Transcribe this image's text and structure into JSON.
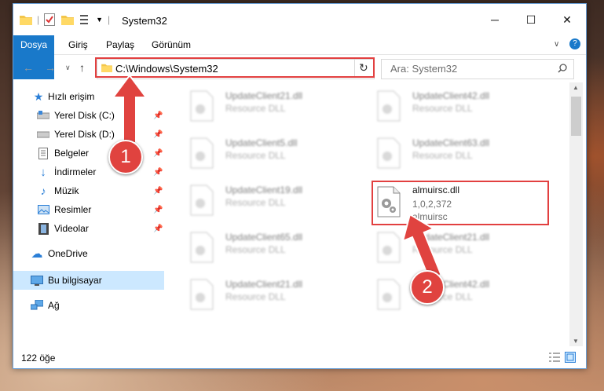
{
  "window": {
    "title": "System32",
    "controls": {
      "minimize": "─",
      "maximize": "☐",
      "close": "✕"
    }
  },
  "ribbon": {
    "tabs": [
      "Dosya",
      "Giriş",
      "Paylaş",
      "Görünüm"
    ],
    "help": "?"
  },
  "address_bar": {
    "path": "C:\\Windows\\System32",
    "refresh": "↻"
  },
  "search": {
    "placeholder": "Ara: System32",
    "icon": "search-icon"
  },
  "sidebar": {
    "quick_access": "Hızlı erişim",
    "items": [
      {
        "label": "Yerel Disk (C:)",
        "icon": "drive-icon",
        "pinned": true
      },
      {
        "label": "Yerel Disk (D:)",
        "icon": "drive-icon",
        "pinned": true
      },
      {
        "label": "Belgeler",
        "icon": "documents-icon",
        "pinned": true
      },
      {
        "label": "İndirmeler",
        "icon": "download-icon",
        "pinned": true
      },
      {
        "label": "Müzik",
        "icon": "music-icon",
        "pinned": true
      },
      {
        "label": "Resimler",
        "icon": "pictures-icon",
        "pinned": true
      },
      {
        "label": "Videolar",
        "icon": "videos-icon",
        "pinned": true
      }
    ],
    "onedrive": "OneDrive",
    "this_pc": "Bu bilgisayar",
    "network": "Ağ"
  },
  "files": {
    "col1": [
      {
        "name": "UpdateClient21.dll",
        "type": "Resource DLL"
      },
      {
        "name": "UpdateClient5.dll",
        "type": "Resource DLL"
      },
      {
        "name": "UpdateClient19.dll",
        "type": "Resource DLL"
      },
      {
        "name": "UpdateClient65.dll",
        "type": "Resource DLL"
      },
      {
        "name": "UpdateClient21.dll",
        "type": "Resource DLL"
      }
    ],
    "col2": [
      {
        "name": "UpdateClient42.dll",
        "type": "Resource DLL"
      },
      {
        "name": "UpdateClient63.dll",
        "type": "Resource DLL"
      },
      {
        "name": "almuirsc.dll",
        "version": "1,0,2,372",
        "type": "almuirsc",
        "highlighted": true
      },
      {
        "name": "UpdateClient21.dll",
        "type": "Resource DLL"
      },
      {
        "name": "UpdateClient42.dll",
        "type": "Resource DLL"
      }
    ]
  },
  "status_bar": {
    "count": "122 öğe"
  },
  "annotations": {
    "step1": "1",
    "step2": "2",
    "color": "#e0433f"
  }
}
